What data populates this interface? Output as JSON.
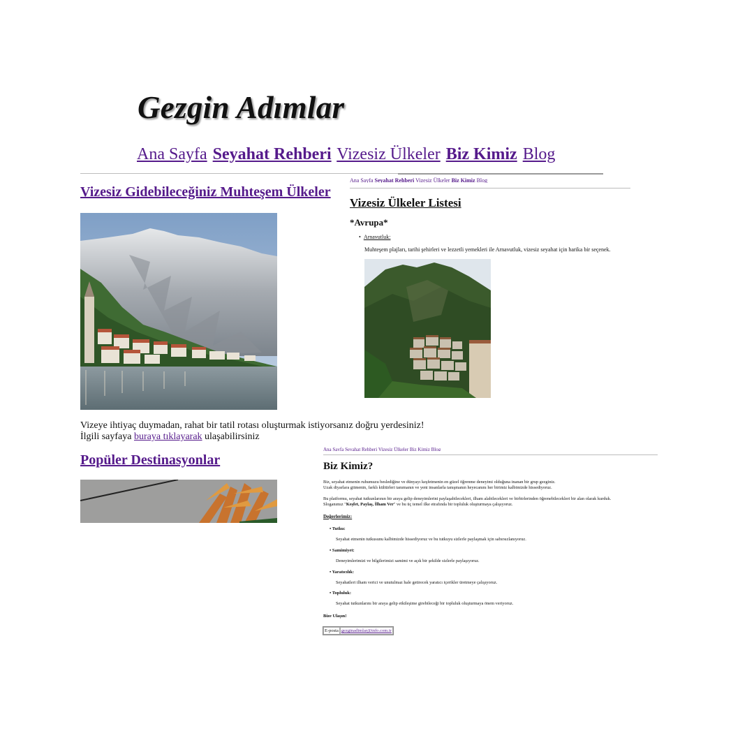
{
  "main": {
    "site_title": "Gezgin Adımlar",
    "nav": [
      "Ana Sayfa",
      "Seyahat Rehberi",
      "Vizesiz Ülkeler",
      "Biz Kimiz",
      "Blog"
    ],
    "featured_heading": "Vizesiz Gidebileceğiniz Muhteşem Ülkeler",
    "intro_line1": "Vizeye ihtiyaç duymadan, rahat bir tatil rotası oluşturmak istiyorsanız doğru yerdesiniz!",
    "intro_line2_prefix": "İlgili sayfaya ",
    "intro_link": "buraya tıklayarak",
    "intro_line2_suffix": " ulaşabilirsiniz",
    "popular_heading": "Popüler Destinasyonlar"
  },
  "visa_page": {
    "nav": [
      "Ana Sayfa",
      "Seyahat Rehberi",
      "Vizesiz Ülkeler",
      "Biz Kimiz",
      "Blog"
    ],
    "heading": "Vizesiz Ülkeler Listesi",
    "region": "*Avrupa*",
    "country": "Arnavutluk:",
    "description": "Muhteşem plajları, tarihi şehirleri ve lezzetli yemekleri ile Arnavutluk, vizesiz seyahat için harika bir seçenek."
  },
  "about_page": {
    "heading": "Biz Kimiz?",
    "p1_line1": "Biz, seyahat etmenin ruhumuzu beslediğine ve dünyayı keşfetmenin en güzel öğrenme deneyimi olduğuna inanan bir grup gezginiz.",
    "p1_line2": "Uzak diyarlara gitmenin, farklı kültürleri tanımanın ve yeni insanlarla tanışmanın heyecanını her birimiz kalbimizde hissediyoruz.",
    "p2_line1": "Bu platformu, seyahat tutkunlarının bir araya gelip deneyimlerini paylaşabilecekleri, ilham alabilecekleri ve birbirlerinden öğrenebilecekleri bir alan olarak kurduk.",
    "p2_line2_prefix": "Sloganımız \"",
    "p2_slogan": "Keşfet, Paylaş, İlham Ver",
    "p2_line2_suffix": "\" ve bu üç temel ilke etrafında bir topluluk oluşturmaya çalışıyoruz.",
    "values_heading": "Değerlerimiz:",
    "values": [
      {
        "title": "Tutku:",
        "text": "Seyahat etmenin tutkusunu kalbimizde hissediyoruz ve bu tutkuyu sizlerle paylaşmak için sabırsızlanıyoruz."
      },
      {
        "title": "Samimiyet:",
        "text": "Deneyimlerimizi ve bilgilerimizi samimi ve açık bir şekilde sizlerle paylaşıyoruz."
      },
      {
        "title": "Yaratıcılık:",
        "text": "Seyahatleri ilham verici ve unutulmaz hale getirecek yaratıcı içerikler üretmeye çalışıyoruz."
      },
      {
        "title": "Topluluk:",
        "text": "Seyahat tutkunlarını bir araya gelip etkileşime girebileceği bir topluluk oluşturmaya önem veriyoruz."
      }
    ],
    "contact_heading": "Bize Ulaşın!",
    "contact_label": "E-posta",
    "contact_email": "gezginadimlar@info.com.tr"
  }
}
